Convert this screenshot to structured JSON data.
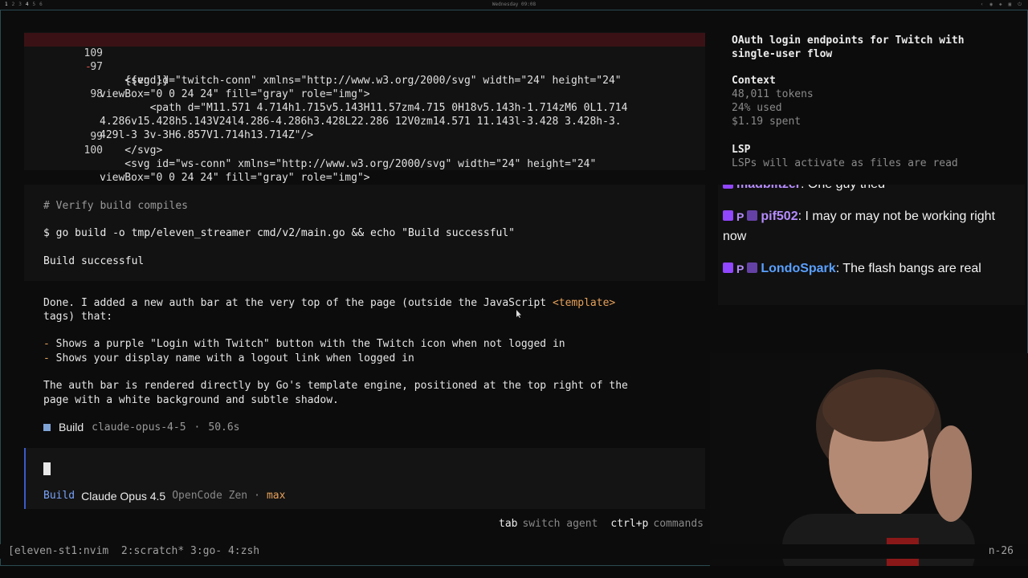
{
  "topbar": {
    "workspaces": [
      "1",
      "2",
      "3",
      "4",
      "5",
      "6"
    ],
    "clock": "Wednesday 09:08"
  },
  "code": {
    "lines": [
      {
        "num": "109",
        "mark": "-",
        "text": "    {{end}}"
      },
      {
        "num": "97",
        "mark": "",
        "text": "    <svg id=\"twitch-conn\" xmlns=\"http://www.w3.org/2000/svg\" width=\"24\" height=\"24\""
      },
      {
        "num": "",
        "mark": "",
        "text": "viewBox=\"0 0 24 24\" fill=\"gray\" role=\"img\">"
      },
      {
        "num": "98",
        "mark": "",
        "text": "        <path d=\"M11.571 4.714h1.715v5.143H11.57zm4.715 0H18v5.143h-1.714zM6 0L1.714"
      },
      {
        "num": "",
        "mark": "",
        "text": "4.286v15.428h5.143V24l4.286-4.286h3.428L22.286 12V0zm14.571 11.143l-3.428 3.428h-3."
      },
      {
        "num": "",
        "mark": "",
        "text": "429l-3 3v-3H6.857V1.714h13.714Z\"/>"
      },
      {
        "num": "99",
        "mark": "",
        "text": "    </svg>"
      },
      {
        "num": "100",
        "mark": "",
        "text": "    <svg id=\"ws-conn\" xmlns=\"http://www.w3.org/2000/svg\" width=\"24\" height=\"24\""
      },
      {
        "num": "",
        "mark": "",
        "text": "viewBox=\"0 0 24 24\" fill=\"gray\" role=\"img\">"
      }
    ]
  },
  "bash": {
    "comment": "# Verify build compiles",
    "command": "$ go build -o tmp/eleven_streamer cmd/v2/main.go && echo \"Build successful\"",
    "output": "Build successful"
  },
  "response": {
    "p1_line1_a": "Done. I added a new auth bar at the very top of the page (outside the JavaScript ",
    "p1_line1_code": "<template>",
    "p1_line2": "tags) that:",
    "bullet1": "Shows a purple \"Login with Twitch\" button with the Twitch icon when not logged in",
    "bullet2": "Shows your display name with a logout link when logged in",
    "p2_line1": "The auth bar is rendered directly by Go's template engine, positioned at the top right of the",
    "p2_line2": "page with a white background and subtle shadow."
  },
  "build_meta": {
    "agent": "Build",
    "model": "claude-opus-4-5",
    "duration": "50.6s",
    "sep": "·"
  },
  "prompt": {
    "agent": "Build",
    "model": "Claude Opus 4.5",
    "provider": "OpenCode Zen",
    "sep": "·",
    "variant": "max"
  },
  "hints": {
    "tab_key": "tab",
    "tab_desc": "switch agent",
    "cmd_key": "ctrl+p",
    "cmd_desc": "commands"
  },
  "sidebar": {
    "title": "OAuth login endpoints for Twitch with single-user flow",
    "context_heading": "Context",
    "tokens": "48,011 tokens",
    "used": "24% used",
    "spent": "$1.19 spent",
    "lsp_heading": "LSP",
    "lsp_text": "LSPs will activate as files are read"
  },
  "chat": {
    "messages": [
      {
        "user": "madblitzer",
        "text": "One guy tried"
      },
      {
        "user": "pif502",
        "text": "I may or may not be working right now"
      },
      {
        "user": "LondoSpark",
        "text": "The flash bangs are real"
      }
    ]
  },
  "tmux": {
    "session": "[eleven-st1:nvim",
    "w2": "2:scratch*",
    "w3": "3:go-",
    "w4": "4:zsh",
    "right": "n-26"
  },
  "colors": {
    "accent_blue": "#7aa2f7",
    "accent_orange": "#e6a15a",
    "twitch_purple": "#9146ff",
    "deletion_bg": "#3a1215"
  }
}
